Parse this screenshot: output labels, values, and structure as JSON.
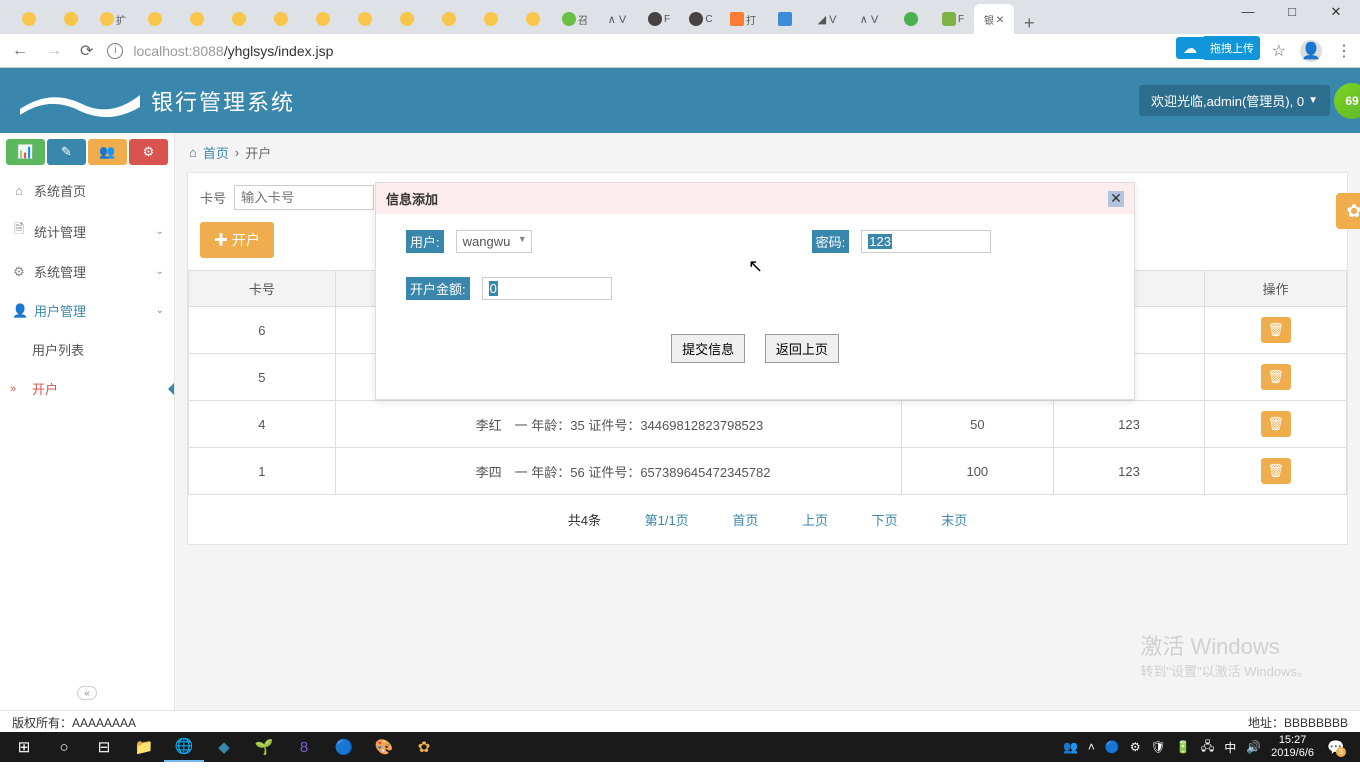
{
  "browser": {
    "url_host": "localhost:8088",
    "url_path": "/yhglsys/index.jsp",
    "active_tab_title": "银",
    "upload_badge": "拖拽上传",
    "newtab": "+",
    "win_min": "—",
    "win_max": "□",
    "win_close": "✕"
  },
  "app": {
    "title": "银行管理系统",
    "welcome": "欢迎光临,admin(管理员), 0",
    "badge": "69"
  },
  "sidebar": {
    "items": [
      {
        "icon": "⌂",
        "label": "系统首页"
      },
      {
        "icon": "🗎",
        "label": "统计管理",
        "expandable": true
      },
      {
        "icon": "⚙",
        "label": "系统管理",
        "expandable": true
      },
      {
        "icon": "👤",
        "label": "用户管理",
        "expandable": true,
        "active": true
      },
      {
        "label": "用户列表",
        "lvl": 2
      },
      {
        "label": "开户",
        "lvl": 2,
        "current": true
      }
    ]
  },
  "breadcrumb": {
    "home_icon": "⌂",
    "home": "首页",
    "sep": "›",
    "current": "开户"
  },
  "search": {
    "label": "卡号",
    "placeholder": "输入卡号"
  },
  "add_button": "✚ 开户",
  "modal": {
    "title": "信息添加",
    "user_label": "用户:",
    "user_value": "wangwu",
    "pass_label": "密码:",
    "pass_value": "123",
    "amount_label": "开户金额:",
    "amount_value": "0",
    "submit": "提交信息",
    "back": "返回上页",
    "close": "✕"
  },
  "table": {
    "headers": {
      "card": "卡号",
      "action": "操作"
    },
    "rows": [
      {
        "card": "6",
        "detail": "",
        "bal": "",
        "pass": ""
      },
      {
        "card": "5",
        "detail": "",
        "bal": "",
        "pass": ""
      },
      {
        "card": "4",
        "detail": "李红　一 年龄：35 证件号：34469812823798523",
        "bal": "50",
        "pass": "123"
      },
      {
        "card": "1",
        "detail": "李四　一 年龄：56 证件号：657389645472345782",
        "bal": "100",
        "pass": "123"
      }
    ]
  },
  "pager": {
    "total": "共4条",
    "page": "第1/1页",
    "first": "首页",
    "prev": "上页",
    "next": "下页",
    "last": "末页"
  },
  "watermark": {
    "l1": "激活 Windows",
    "l2": "转到\"设置\"以激活 Windows。"
  },
  "footer": {
    "left": "版权所有：AAAAAAAA",
    "right": "地址：BBBBBBBB"
  },
  "taskbar": {
    "clock_time": "15:27",
    "clock_date": "2019/6/6",
    "notif_count": "3"
  }
}
